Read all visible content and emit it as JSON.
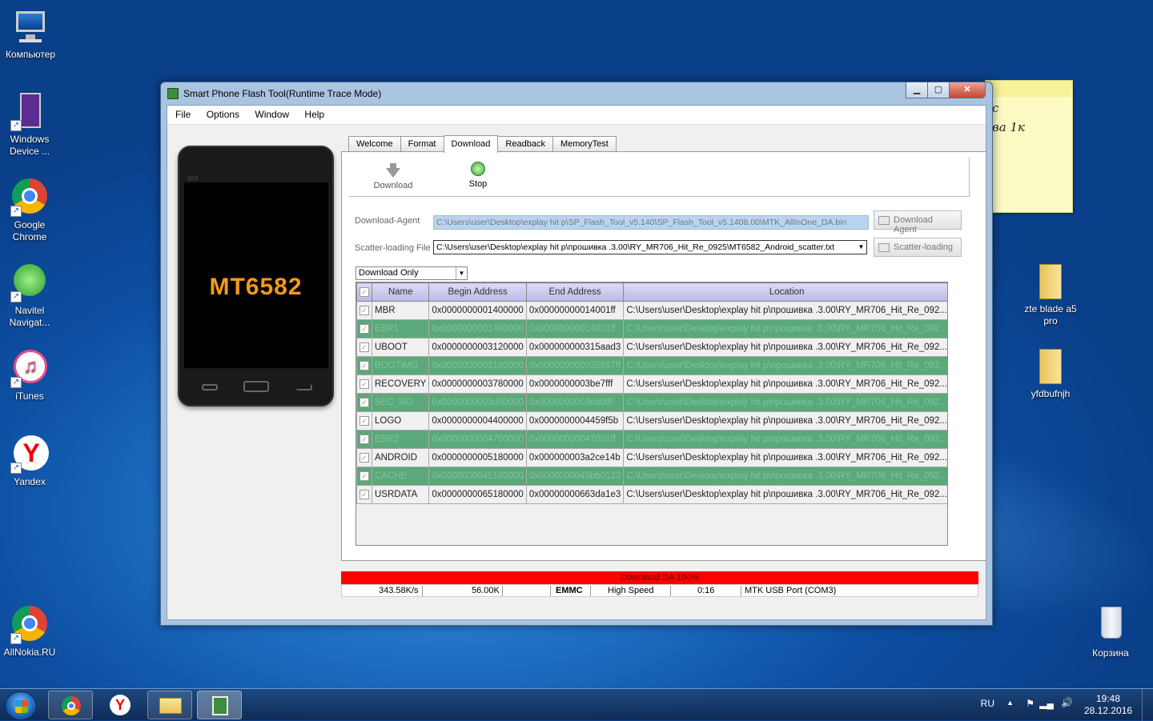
{
  "desktop": {
    "icons": [
      {
        "label": "Компьютер"
      },
      {
        "label": "Windows Device ..."
      },
      {
        "label": "Google Chrome"
      },
      {
        "label": "Navitel Navigat..."
      },
      {
        "label": "iTunes"
      },
      {
        "label": "Yandex"
      },
      {
        "label": "AllNokia.RU"
      },
      {
        "label": "zte blade a5 pro"
      },
      {
        "label": "yfdbufnjh"
      },
      {
        "label": "Корзина"
      }
    ],
    "sticky_text": [
      "с",
      "ва 1к"
    ]
  },
  "window": {
    "title": "Smart Phone Flash Tool(Runtime Trace Mode)",
    "menu": [
      "File",
      "Options",
      "Window",
      "Help"
    ],
    "phone": {
      "brand": "BM",
      "model": "MT6582"
    },
    "tabs": [
      "Welcome",
      "Format",
      "Download",
      "Readback",
      "MemoryTest"
    ],
    "active_tab": "Download",
    "toolbar": {
      "download_label": "Download",
      "stop_label": "Stop"
    },
    "download_agent": {
      "label": "Download-Agent",
      "value": "C:\\Users\\user\\Desktop\\explay hit p\\SP_Flash_Tool_v5.140\\SP_Flash_Tool_v5.1408.00\\MTK_AllInOne_DA.bin",
      "button": "Download Agent"
    },
    "scatter": {
      "label": "Scatter-loading File",
      "value": "C:\\Users\\user\\Desktop\\explay hit p\\прошивка .3.00\\RY_MR706_Hit_Re_0925\\MT6582_Android_scatter.txt",
      "button": "Scatter-loading"
    },
    "mode": "Download Only",
    "table": {
      "columns": [
        "",
        "Name",
        "Begin Address",
        "End Address",
        "Location"
      ],
      "rows": [
        {
          "name": "MBR",
          "begin": "0x0000000001400000",
          "end": "0x00000000014001ff",
          "location": "C:\\Users\\user\\Desktop\\explay hit p\\прошивка .3.00\\RY_MR706_Hit_Re_092...",
          "style": "norm"
        },
        {
          "name": "EBR1",
          "begin": "0x0000000001480000",
          "end": "0x00000000014801ff",
          "location": "C:\\Users\\user\\Desktop\\explay hit p\\прошивка .3.00\\RY_MR706_Hit_Re_092...",
          "style": "green"
        },
        {
          "name": "UBOOT",
          "begin": "0x0000000003120000",
          "end": "0x000000000315aad3",
          "location": "C:\\Users\\user\\Desktop\\explay hit p\\прошивка .3.00\\RY_MR706_Hit_Re_092...",
          "style": "norm"
        },
        {
          "name": "BOOTIMG",
          "begin": "0x0000000003180000",
          "end": "0x000000000035897ff",
          "location": "C:\\Users\\user\\Desktop\\explay hit p\\прошивка .3.00\\RY_MR706_Hit_Re_092...",
          "style": "green"
        },
        {
          "name": "RECOVERY",
          "begin": "0x0000000003780000",
          "end": "0x0000000003be7fff",
          "location": "C:\\Users\\user\\Desktop\\explay hit p\\прошивка .3.00\\RY_MR706_Hit_Re_092...",
          "style": "norm"
        },
        {
          "name": "SEC_RO",
          "begin": "0x0000000003d80000",
          "end": "0x0000000003da0fff",
          "location": "C:\\Users\\user\\Desktop\\explay hit p\\прошивка .3.00\\RY_MR706_Hit_Re_092...",
          "style": "green"
        },
        {
          "name": "LOGO",
          "begin": "0x0000000004400000",
          "end": "0x0000000004459f5b",
          "location": "C:\\Users\\user\\Desktop\\explay hit p\\прошивка .3.00\\RY_MR706_Hit_Re_092...",
          "style": "norm"
        },
        {
          "name": "EBR2",
          "begin": "0x0000000004700000",
          "end": "0x00000000047001ff",
          "location": "C:\\Users\\user\\Desktop\\explay hit p\\прошивка .3.00\\RY_MR706_Hit_Re_092...",
          "style": "green"
        },
        {
          "name": "ANDROID",
          "begin": "0x0000000005180000",
          "end": "0x000000003a2ce14b",
          "location": "C:\\Users\\user\\Desktop\\explay hit p\\прошивка .3.00\\RY_MR706_Hit_Re_092...",
          "style": "norm"
        },
        {
          "name": "CACHE",
          "begin": "0x0000000045180000",
          "end": "0x0000000045bb0123",
          "location": "C:\\Users\\user\\Desktop\\explay hit p\\прошивка .3.00\\RY_MR706_Hit_Re_092...",
          "style": "green"
        },
        {
          "name": "USRDATA",
          "begin": "0x0000000065180000",
          "end": "0x00000000663da1e3",
          "location": "C:\\Users\\user\\Desktop\\explay hit p\\прошивка .3.00\\RY_MR706_Hit_Re_092...",
          "style": "norm"
        }
      ]
    },
    "progress": {
      "text": "Download DA 100%",
      "value": 1.0,
      "color": "#ff0000"
    },
    "status": {
      "speed": "343.58K/s",
      "size": "56.00K",
      "storage": "EMMC",
      "usb_speed": "High Speed",
      "time": "0:16",
      "port": "MTK USB Port (COM3)"
    }
  },
  "taskbar": {
    "lang": "RU",
    "time": "19:48",
    "date": "28.12.2016"
  },
  "colors": {
    "green_row": "#5ba87a",
    "progress": "#ff0000",
    "header": "#c0c0ee"
  }
}
